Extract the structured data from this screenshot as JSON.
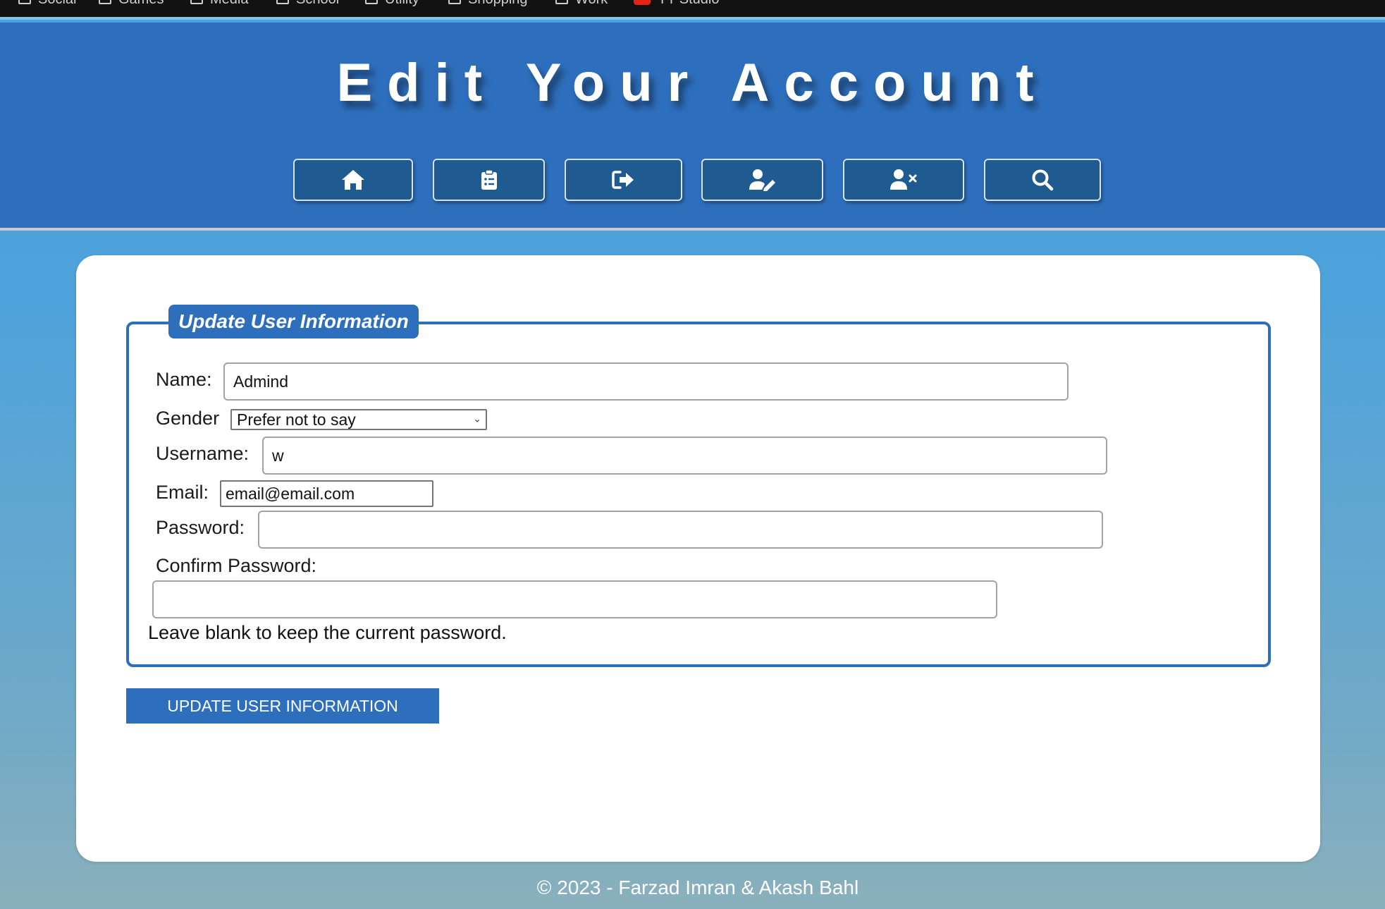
{
  "bookmarks": [
    {
      "label": "Social",
      "icon": "folder-icon"
    },
    {
      "label": "Games",
      "icon": "folder-icon"
    },
    {
      "label": "Media",
      "icon": "folder-icon"
    },
    {
      "label": "School",
      "icon": "folder-icon"
    },
    {
      "label": "Utility",
      "icon": "folder-icon"
    },
    {
      "label": "Shopping",
      "icon": "folder-icon"
    },
    {
      "label": "Work",
      "icon": "folder-icon"
    },
    {
      "label": "YT Studio",
      "icon": "youtube-icon"
    }
  ],
  "header": {
    "title": "Edit Your Account",
    "nav": [
      {
        "icon": "home-icon"
      },
      {
        "icon": "clipboard-list-icon"
      },
      {
        "icon": "sign-out-icon"
      },
      {
        "icon": "user-edit-icon"
      },
      {
        "icon": "user-remove-icon"
      },
      {
        "icon": "search-icon"
      }
    ]
  },
  "form": {
    "legend": "Update User Information",
    "name_label": "Name:",
    "name_value": "Admind",
    "gender_label": "Gender",
    "gender_value": "Prefer not to say",
    "username_label": "Username:",
    "username_value": "w",
    "email_label": "Email:",
    "email_value": "email@email.com",
    "password_label": "Password:",
    "password_value": "",
    "confirm_label": "Confirm Password:",
    "confirm_value": "",
    "hint": "Leave blank to keep the current password.",
    "submit_label": "UPDATE USER INFORMATION"
  },
  "footer": {
    "text": "© 2023 - Farzad Imran & Akash Bahl"
  },
  "colors": {
    "header_bg": "#2e6fbd",
    "nav_button_bg": "#1f5a91",
    "accent": "#2e6fbd",
    "page_gradient_top": "#4aa0de",
    "page_gradient_bottom": "#8ab0bc"
  }
}
